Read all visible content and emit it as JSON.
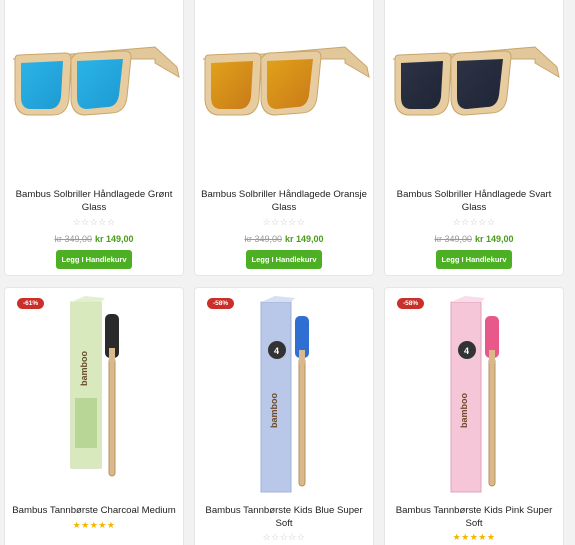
{
  "products": [
    {
      "title": "Bambus Solbriller Håndlagede Grønt Glass",
      "old_price": "kr 349,00",
      "new_price": "kr 149,00",
      "button": "Legg I Handlekurv",
      "stars": "☆☆☆☆☆",
      "lens_color": "#2ab4e8",
      "lens_color2": "#1e9ad1"
    },
    {
      "title": "Bambus Solbriller Håndlagede Oransje Glass",
      "old_price": "kr 349,00",
      "new_price": "kr 149,00",
      "button": "Legg I Handlekurv",
      "stars": "☆☆☆☆☆",
      "lens_color": "#e0a21a",
      "lens_color2": "#c97a18"
    },
    {
      "title": "Bambus Solbriller Håndlagede Svart Glass",
      "old_price": "kr 349,00",
      "new_price": "kr 149,00",
      "button": "Legg I Handlekurv",
      "stars": "☆☆☆☆☆",
      "lens_color": "#2c3346",
      "lens_color2": "#1f2535"
    },
    {
      "title": "Bambus Tannbørste Charcoal Medium",
      "badge": "-61%",
      "stars": "★★★★★",
      "box_color": "#d9ebc0",
      "bristle_color": "#2a2a2a",
      "brand": "bamboo"
    },
    {
      "title": "Bambus Tannbørste Kids Blue Super Soft",
      "badge": "-58%",
      "stars": "☆☆☆☆☆",
      "box_color": "#b9c8e8",
      "bristle_color": "#2f6fd1",
      "brand": "bamboo"
    },
    {
      "title": "Bambus Tannbørste Kids Pink Super Soft",
      "badge": "-58%",
      "stars": "★★★★★",
      "box_color": "#f5c6d8",
      "bristle_color": "#e8588a",
      "brand": "bamboo"
    }
  ]
}
